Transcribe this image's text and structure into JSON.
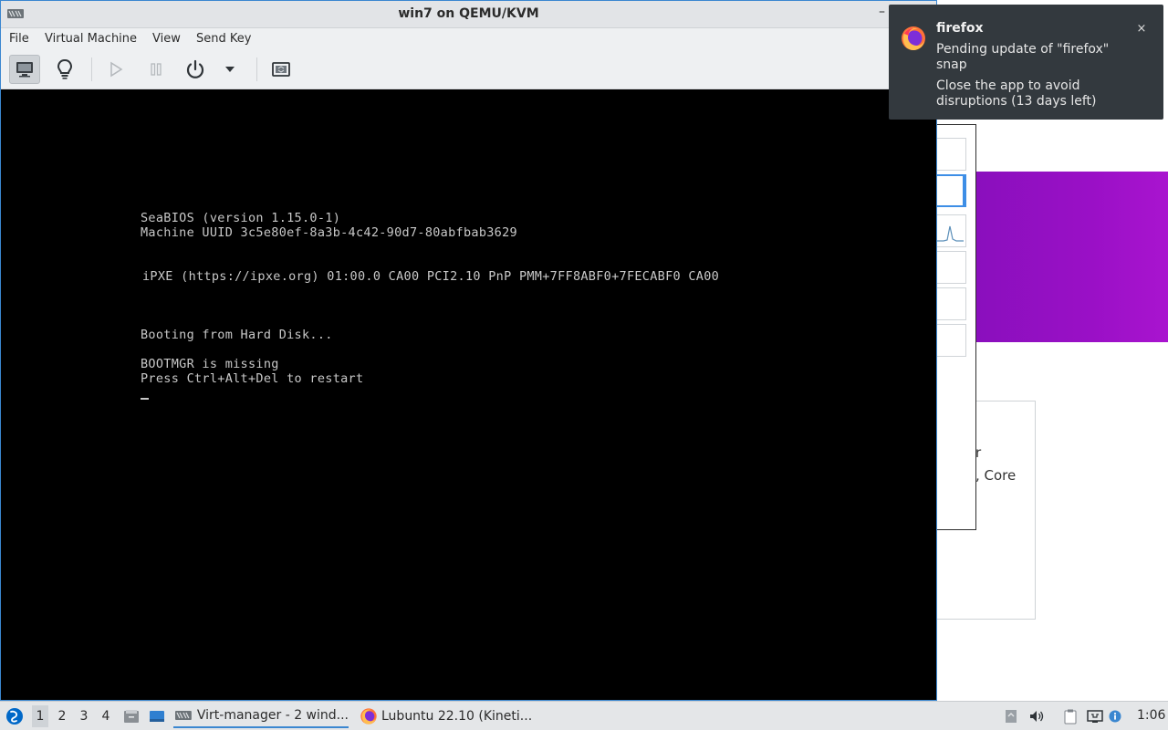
{
  "vm_window": {
    "title": "win7 on QEMU/KVM",
    "minimize_glyph": "–",
    "menus": [
      "File",
      "Virtual Machine",
      "View",
      "Send Key"
    ],
    "toolbar_icons": [
      "monitor-icon",
      "lightbulb-icon",
      "play-icon",
      "pause-icon",
      "power-icon",
      "dropdown-arrow-icon",
      "fullscreen-icon"
    ]
  },
  "console": {
    "lines": [
      "SeaBIOS (version 1.15.0-1)",
      "Machine UUID 3c5e80ef-8a3b-4c42-90d7-80abfbab3629",
      "iPXE (https://ipxe.org) 01:00.0 CA00 PCI2.10 PnP PMM+7FF8ABF0+7FECABF0 CA00",
      "Booting from Hard Disk...",
      "BOOTMGR is missing",
      "Press Ctrl+Alt+Del to restart"
    ]
  },
  "notification": {
    "app": "firefox",
    "body1": "Pending update of \"firefox\" snap",
    "body2": "Close the app to avoid disruptions (13 days left)",
    "close_glyph": "×"
  },
  "background_app": {
    "text_line1": "r",
    "text_line2": ", Core",
    "accent_color": "#9a10c6"
  },
  "taskbar": {
    "workspaces": [
      "1",
      "2",
      "3",
      "4"
    ],
    "active_workspace": "1",
    "tasks": [
      "Virt-manager - 2 wind...",
      "Lubuntu 22.10 (Kineti..."
    ],
    "clock": "1:06"
  }
}
